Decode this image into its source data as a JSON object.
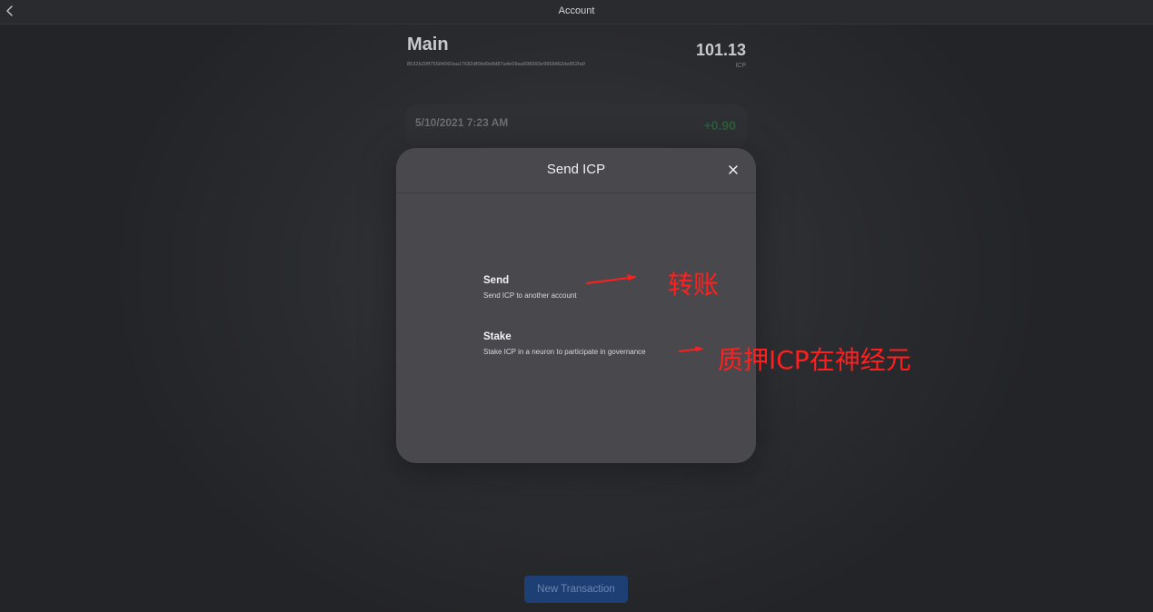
{
  "header": {
    "title": "Account",
    "back_icon": "chevron-left-icon"
  },
  "account": {
    "name": "Main",
    "id": "8532b20ff75584060aa17682df0bd9e8d87a4e09aa598993e9958462de852fa9",
    "balance": "101.13",
    "unit": "ICP"
  },
  "transaction": {
    "date": "5/10/2021 7:23 AM",
    "amount": "+0.90"
  },
  "modal": {
    "title": "Send ICP",
    "close_icon": "close-icon",
    "options": [
      {
        "title": "Send",
        "description": "Send ICP to another account"
      },
      {
        "title": "Stake",
        "description": "Stake ICP in a neuron to participate in governance"
      }
    ]
  },
  "annotations": {
    "send": "转账",
    "stake": "质押ICP在神经元",
    "color": "#ff1f1f"
  },
  "footer": {
    "new_transaction_label": "New Transaction",
    "accent": "#1e3f73"
  }
}
